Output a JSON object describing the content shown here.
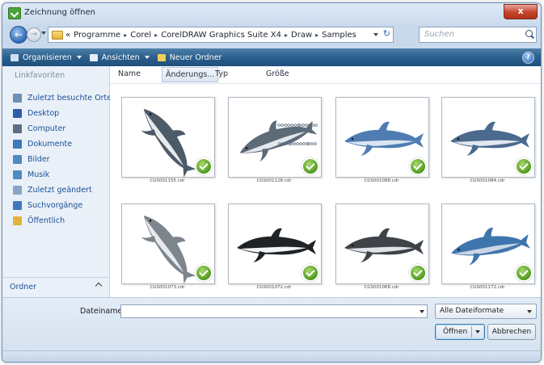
{
  "window": {
    "title": "Zeichnung öffnen",
    "close_glyph": "x"
  },
  "address": {
    "back_glyph": "←",
    "forward_glyph": "→",
    "overflow_glyph": "«",
    "crumbs": [
      "Programme",
      "Corel",
      "CorelDRAW Graphics Suite X4",
      "Draw",
      "Samples"
    ],
    "separator": "▸",
    "refresh_glyph": "↻"
  },
  "search": {
    "placeholder": "Suchen",
    "icon": "search-icon"
  },
  "toolbar": {
    "organize_label": "Organisieren",
    "views_label": "Ansichten",
    "new_folder_label": "Neuer Ordner",
    "help_glyph": "?"
  },
  "sidebar": {
    "heading": "Linkfavoriten",
    "items": [
      {
        "label": "Zuletzt besuchte Orte",
        "icon": "recent-places-icon",
        "color": "#6e8fb5"
      },
      {
        "label": "Desktop",
        "icon": "desktop-icon",
        "color": "#2d5ea8"
      },
      {
        "label": "Computer",
        "icon": "computer-icon",
        "color": "#5b6f86"
      },
      {
        "label": "Dokumente",
        "icon": "documents-icon",
        "color": "#3f78b8"
      },
      {
        "label": "Bilder",
        "icon": "pictures-icon",
        "color": "#4f8bc0"
      },
      {
        "label": "Musik",
        "icon": "music-icon",
        "color": "#4f8bc0"
      },
      {
        "label": "Zuletzt geändert",
        "icon": "recent-changed-icon",
        "color": "#8aa4c4"
      },
      {
        "label": "Suchvorgänge",
        "icon": "searches-icon",
        "color": "#3f78b8"
      },
      {
        "label": "Öffentlich",
        "icon": "public-folder-icon",
        "color": "#e2b23a"
      }
    ],
    "footer_label": "Ordner"
  },
  "columns": [
    "Name",
    "Änderungs...",
    "Typ",
    "Größe"
  ],
  "files": [
    {
      "name": "CGS001155.cdr",
      "pose": "diving"
    },
    {
      "name": "CGS001128.cdr",
      "pose": "leaping-splash"
    },
    {
      "name": "CGS001088.cdr",
      "pose": "swimming"
    },
    {
      "name": "CGS001084.cdr",
      "pose": "swimming"
    },
    {
      "name": "CGS001073.cdr",
      "pose": "diving"
    },
    {
      "name": "CGS001072.cdr",
      "pose": "swimming"
    },
    {
      "name": "CGS001068.cdr",
      "pose": "swimming"
    },
    {
      "name": "CGS001172.cdr",
      "pose": "swimming-leap"
    }
  ],
  "footer": {
    "filename_label": "Dateiname:",
    "filename_value": "",
    "filter_value": "Alle Dateiformate",
    "open_label": "Öffnen",
    "cancel_label": "Abbrechen"
  },
  "colors": {
    "toolbar": "#2b5f8c",
    "link": "#1b4f97",
    "badge": "#4f9a1f"
  }
}
